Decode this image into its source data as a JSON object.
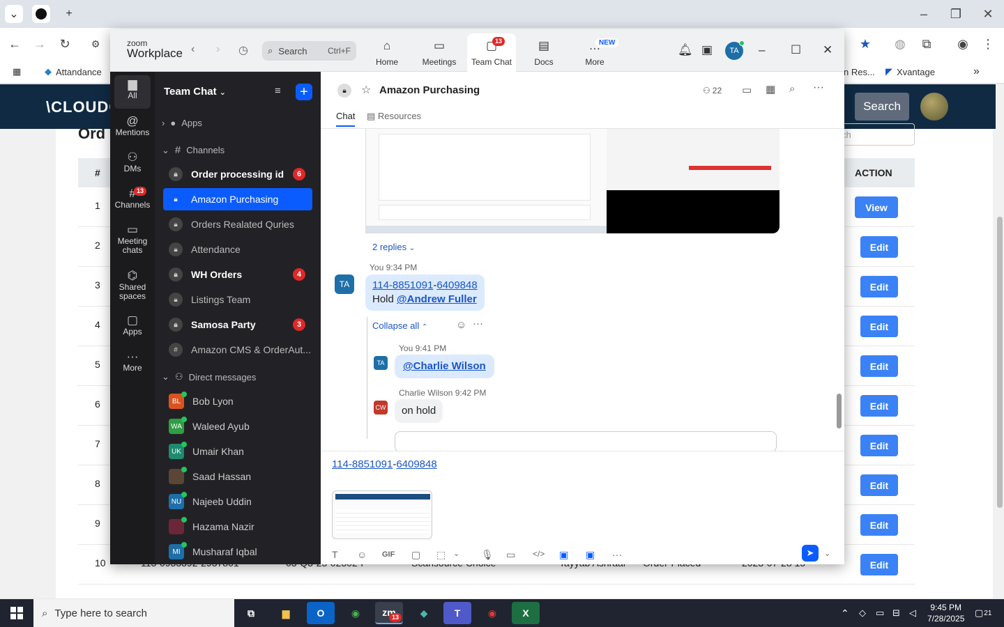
{
  "browser": {
    "bookmarks": [
      {
        "label": "Attandance"
      },
      {
        "label": "n Res..."
      },
      {
        "label": "Xvantage"
      }
    ]
  },
  "webpage": {
    "logo": "\\CLOUDC",
    "search_label": "Search",
    "page_title": "Ord",
    "filter_placeholder": "ch",
    "columns": {
      "num": "#",
      "action": "ACTION"
    },
    "rows": [
      {
        "num": "1",
        "action": "View"
      },
      {
        "num": "2",
        "action": "Edit"
      },
      {
        "num": "3",
        "action": "Edit"
      },
      {
        "num": "4",
        "action": "Edit"
      },
      {
        "num": "5",
        "action": "Edit"
      },
      {
        "num": "6",
        "action": "Edit"
      },
      {
        "num": "7",
        "action": "Edit"
      },
      {
        "num": "8",
        "action": "Edit"
      },
      {
        "num": "9",
        "action": "Edit"
      },
      {
        "num": "10",
        "action": "Edit",
        "c1": "113-0933392-2937801",
        "c2": "03-Q3-23-02302-F",
        "c3": "Scansource Choice",
        "c4": "Tayyab Ashraai",
        "c5": "Order-Placed",
        "c6": "2023-07-28 15"
      }
    ]
  },
  "taskbar": {
    "search_placeholder": "Type here to search",
    "time": "9:45 PM",
    "date": "7/28/2025",
    "notif_count": "21",
    "zoom_badge": "13"
  },
  "zoom": {
    "logo_top": "zoom",
    "logo_bottom": "Workplace",
    "search_label": "Search",
    "search_shortcut": "Ctrl+F",
    "tabs": [
      {
        "label": "Home"
      },
      {
        "label": "Meetings"
      },
      {
        "label": "Team Chat",
        "badge": "13"
      },
      {
        "label": "Docs"
      },
      {
        "label": "More",
        "badge": "NEW"
      }
    ],
    "avatar": "TA",
    "rail": [
      {
        "label": "All"
      },
      {
        "label": "Mentions"
      },
      {
        "label": "DMs"
      },
      {
        "label": "Channels",
        "badge": "13"
      },
      {
        "label": "Meeting chats"
      },
      {
        "label": "Shared spaces"
      },
      {
        "label": "Apps"
      },
      {
        "label": "More"
      }
    ],
    "sidebar": {
      "title": "Team Chat",
      "apps": "Apps",
      "channels_heading": "Channels",
      "channels": [
        {
          "name": "Order processing id",
          "badge": "6"
        },
        {
          "name": "Amazon Purchasing"
        },
        {
          "name": "Orders Realated Quries"
        },
        {
          "name": "Attendance"
        },
        {
          "name": "WH Orders",
          "badge": "4"
        },
        {
          "name": "Listings Team"
        },
        {
          "name": "Samosa Party",
          "badge": "3"
        },
        {
          "name": "Amazon CMS & OrderAut..."
        }
      ],
      "dm_heading": "Direct messages",
      "dms": [
        {
          "initials": "BL",
          "name": "Bob Lyon",
          "color": "#d9531e"
        },
        {
          "initials": "WA",
          "name": "Waleed Ayub",
          "color": "#2f9e44"
        },
        {
          "initials": "UK",
          "name": "Umair Khan",
          "color": "#1f8a70"
        },
        {
          "initials": "",
          "name": "Saad Hassan",
          "color": "#5a4636"
        },
        {
          "initials": "NU",
          "name": "Najeeb Uddin",
          "color": "#1e6fa8"
        },
        {
          "initials": "",
          "name": "Hazama Nazir",
          "color": "#6b2737"
        },
        {
          "initials": "MI",
          "name": "Musharaf Iqbal",
          "color": "#1e6fa8"
        }
      ]
    },
    "chat": {
      "title": "Amazon Purchasing",
      "members": "22",
      "tab_chat": "Chat",
      "tab_resources": "Resources",
      "replies": "2 replies",
      "msg1_meta": "You 9:34 PM",
      "msg1_avatar": "TA",
      "msg1_link_a": "114-8851091",
      "msg1_link_sep": "-",
      "msg1_link_b": "6409848",
      "msg1_hold": "Hold",
      "msg1_mention": "@Andrew Fuller",
      "collapse": "Collapse all",
      "reply1_meta": "You 9:41 PM",
      "reply1_avatar": "TA",
      "reply1_mention": "@Charlie Wilson",
      "reply2_name": "Charlie Wilson",
      "reply2_time": "9:42 PM",
      "reply2_avatar": "CW",
      "reply2_text": "on hold"
    },
    "compose": {
      "link_a": "114-8851091",
      "link_sep": "-",
      "link_b": "6409848",
      "gif": "GIF"
    }
  }
}
